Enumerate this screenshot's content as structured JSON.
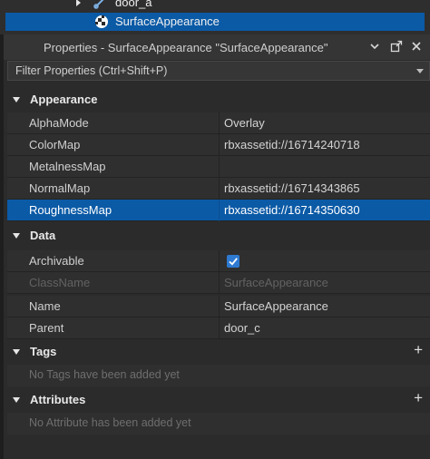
{
  "explorer": {
    "items": [
      {
        "label": "door_a",
        "icon": "model-icon",
        "expanded": false
      },
      {
        "label": "SurfaceAppearance",
        "icon": "surface-appearance-icon",
        "selected": true
      }
    ]
  },
  "panel": {
    "title": "Properties - SurfaceAppearance \"SurfaceAppearance\"",
    "filter_placeholder": "Filter Properties (Ctrl+Shift+P)"
  },
  "groups": {
    "appearance": {
      "label": "Appearance",
      "rows": [
        {
          "name": "AlphaMode",
          "value": "Overlay"
        },
        {
          "name": "ColorMap",
          "value": "rbxassetid://16714240718"
        },
        {
          "name": "MetalnessMap",
          "value": ""
        },
        {
          "name": "NormalMap",
          "value": "rbxassetid://16714343865"
        },
        {
          "name": "RoughnessMap",
          "value": "rbxassetid://16714350630"
        }
      ]
    },
    "data": {
      "label": "Data",
      "rows": [
        {
          "name": "Archivable",
          "value": "",
          "checked": true
        },
        {
          "name": "ClassName",
          "value": "SurfaceAppearance"
        },
        {
          "name": "Name",
          "value": "SurfaceAppearance"
        },
        {
          "name": "Parent",
          "value": "door_c"
        }
      ]
    },
    "tags": {
      "label": "Tags",
      "empty_text": "No Tags have been added yet"
    },
    "attributes": {
      "label": "Attributes",
      "empty_text": "No Attribute has been added yet"
    }
  },
  "colors": {
    "selection": "#0b5aa6",
    "checkbox": "#2e7ad1",
    "background": "#2b2b2b"
  }
}
